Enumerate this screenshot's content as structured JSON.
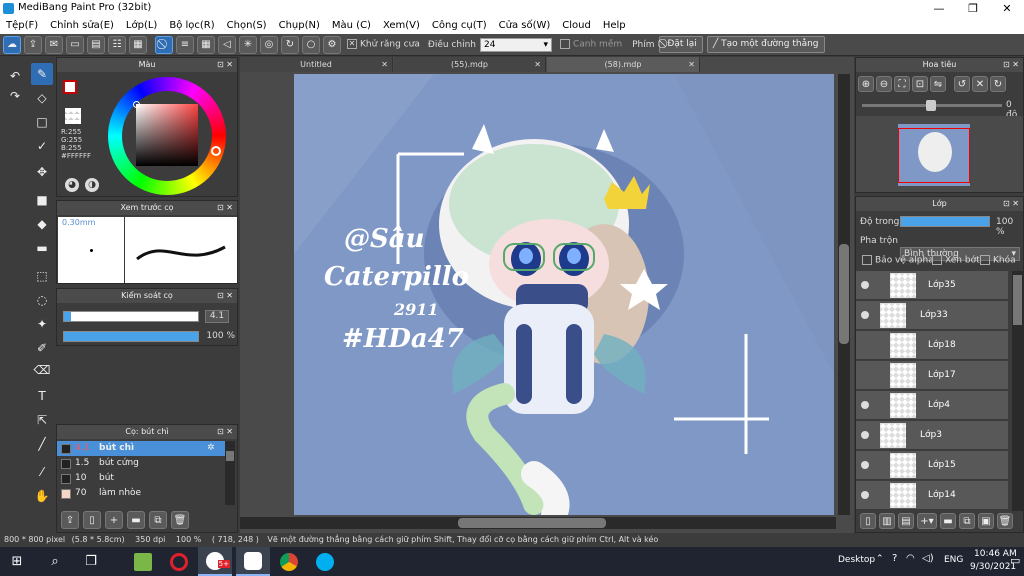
{
  "window": {
    "title": "MediBang Paint Pro (32bit)"
  },
  "menu": [
    "Tệp(F)",
    "Chỉnh sửa(E)",
    "Lớp(L)",
    "Bộ lọc(R)",
    "Chọn(S)",
    "Chụp(N)",
    "Màu (C)",
    "Xem(V)",
    "Công cụ(T)",
    "Cửa số(W)",
    "Cloud",
    "Help"
  ],
  "toolbar": {
    "antialias_label": "Khử răng cưa",
    "adjust_label": "Điều chỉnh",
    "adjust_value": "24",
    "edge_label": "Canh mềm",
    "key_label": "Phím",
    "reset_label": "Đặt lại",
    "straight_label": "Tạo một đường thẳng"
  },
  "color_panel": {
    "title": "Màu",
    "r": "R:255",
    "g": "G:255",
    "b": "B:255",
    "hex": "#FFFFFF"
  },
  "brush_preview": {
    "title": "Xem trước cọ",
    "size": "0.30mm"
  },
  "brush_control": {
    "title": "Kiểm soát cọ",
    "size_value": "4.1",
    "opacity_value": "100 %",
    "size_fraction": 0.05,
    "opacity_fraction": 1.0
  },
  "brush_list": {
    "title": "Cọ: bút chì",
    "items": [
      {
        "size": "4.1",
        "name": "bút chì",
        "selected": true
      },
      {
        "size": "1.5",
        "name": "bút cứng",
        "selected": false
      },
      {
        "size": "10",
        "name": "bút",
        "selected": false
      },
      {
        "size": "70",
        "name": "làm nhòe",
        "selected": false
      }
    ]
  },
  "tabs": [
    "Untitled",
    "(55).mdp",
    "(58).mdp"
  ],
  "canvas_text": {
    "line1": "@Sâu",
    "line2": "Caterpillo",
    "line3": "2911",
    "line4": "#HDa47"
  },
  "navigator": {
    "title": "Hoa tiêu",
    "angle": "0 độ"
  },
  "layer_panel": {
    "title": "Lớp",
    "opacity_label": "Độ trong",
    "opacity_value": "100 %",
    "opacity_fraction": 1.0,
    "blend_label": "Pha trộn",
    "blend_value": "Bình thường",
    "protect_alpha": "Bảo vệ alpha",
    "clipping": "Xén bớt",
    "lock": "Khóa",
    "layers": [
      "Lớp35",
      "Lớp33",
      "Lớp18",
      "Lớp17",
      "Lớp4",
      "Lớp3",
      "Lớp15",
      "Lớp14"
    ]
  },
  "status": {
    "size": "800 * 800 pixel",
    "cm": "(5.8 * 5.8cm)",
    "dpi": "350 dpi",
    "zoom": "100 %",
    "coords": "( 718, 248 )",
    "hint": "Vẽ một đường thẳng bằng cách giữ phím Shift, Thay đổi cỡ cọ bằng cách giữ phím Ctrl, Alt và kéo"
  },
  "taskbar": {
    "desktop": "Desktop",
    "lang": "ENG",
    "time": "10:46 AM",
    "date": "9/30/2021",
    "badge": "5+"
  },
  "colors": {
    "accent": "#2f6db5",
    "canvas_bg": "#8098c5",
    "brush_selected": "#4a90d9"
  }
}
